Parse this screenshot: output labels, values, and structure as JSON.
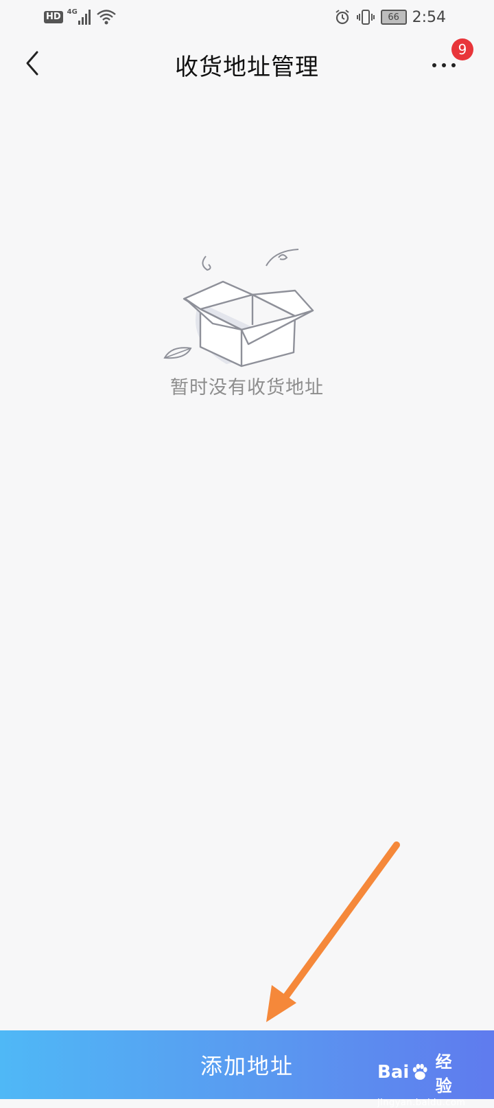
{
  "status_bar": {
    "hd_label": "HD",
    "network_label": "4G",
    "battery_level": "66",
    "time": "2:54",
    "icons": [
      "signal-icon",
      "wifi-icon",
      "alarm-icon",
      "vibrate-icon",
      "battery-icon"
    ]
  },
  "header": {
    "title": "收货地址管理",
    "back_icon": "chevron-left-icon",
    "more_icon": "more-dots-icon",
    "notification_count": "9"
  },
  "empty_state": {
    "illustration": "empty-box-icon",
    "message": "暂时没有收货地址"
  },
  "footer": {
    "add_button_label": "添加地址",
    "gradient_colors": [
      "#4fb8f6",
      "#5a98f0",
      "#5f7bee"
    ]
  },
  "watermark": {
    "brand_bai": "Bai",
    "brand_jingyan": "经验",
    "url": "jingyan.baidu.com"
  },
  "annotation": {
    "arrow_color": "#f5883a"
  }
}
